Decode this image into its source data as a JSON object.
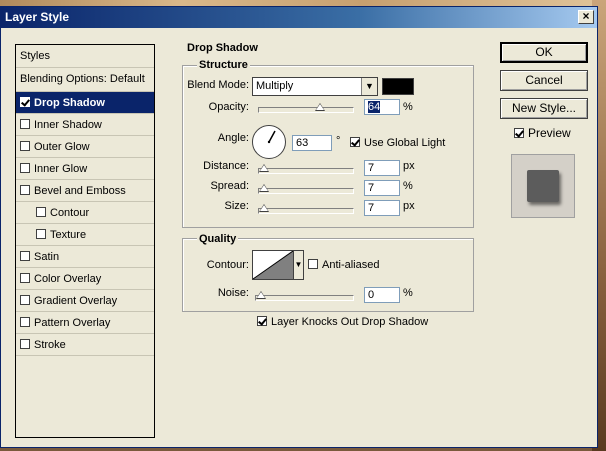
{
  "window": {
    "title": "Layer Style",
    "close_glyph": "×"
  },
  "styles_panel": {
    "header": "Styles",
    "blending": "Blending Options: Default",
    "items": [
      {
        "label": "Drop Shadow",
        "checked": true,
        "selected": true
      },
      {
        "label": "Inner Shadow",
        "checked": false
      },
      {
        "label": "Outer Glow",
        "checked": false
      },
      {
        "label": "Inner Glow",
        "checked": false
      },
      {
        "label": "Bevel and Emboss",
        "checked": false
      },
      {
        "label": "Contour",
        "checked": false,
        "sub": true
      },
      {
        "label": "Texture",
        "checked": false,
        "sub": true
      },
      {
        "label": "Satin",
        "checked": false
      },
      {
        "label": "Color Overlay",
        "checked": false
      },
      {
        "label": "Gradient Overlay",
        "checked": false
      },
      {
        "label": "Pattern Overlay",
        "checked": false
      },
      {
        "label": "Stroke",
        "checked": false
      }
    ]
  },
  "drop_shadow": {
    "title": "Drop Shadow",
    "structure": {
      "title": "Structure",
      "blend_mode_label": "Blend Mode:",
      "blend_mode_value": "Multiply",
      "shadow_color": "#000000",
      "opacity_label": "Opacity:",
      "opacity_value": "64",
      "opacity_unit": "%",
      "angle_label": "Angle:",
      "angle_value": "63",
      "angle_unit": "°",
      "use_global_light": "Use Global Light",
      "use_global_light_checked": true,
      "distance_label": "Distance:",
      "distance_value": "7",
      "distance_unit": "px",
      "spread_label": "Spread:",
      "spread_value": "7",
      "spread_unit": "%",
      "size_label": "Size:",
      "size_value": "7",
      "size_unit": "px"
    },
    "quality": {
      "title": "Quality",
      "contour_label": "Contour:",
      "anti_aliased": "Anti-aliased",
      "anti_aliased_checked": false,
      "noise_label": "Noise:",
      "noise_value": "0",
      "noise_unit": "%"
    },
    "knocks_out": "Layer Knocks Out Drop Shadow",
    "knocks_out_checked": true
  },
  "buttons": {
    "ok": "OK",
    "cancel": "Cancel",
    "new_style": "New Style...",
    "preview": "Preview",
    "preview_checked": true
  },
  "icons": {
    "checkbox": "checkbox-icon",
    "dropdown": "chevron-down-icon",
    "angle_dial": "angle-dial-icon"
  }
}
